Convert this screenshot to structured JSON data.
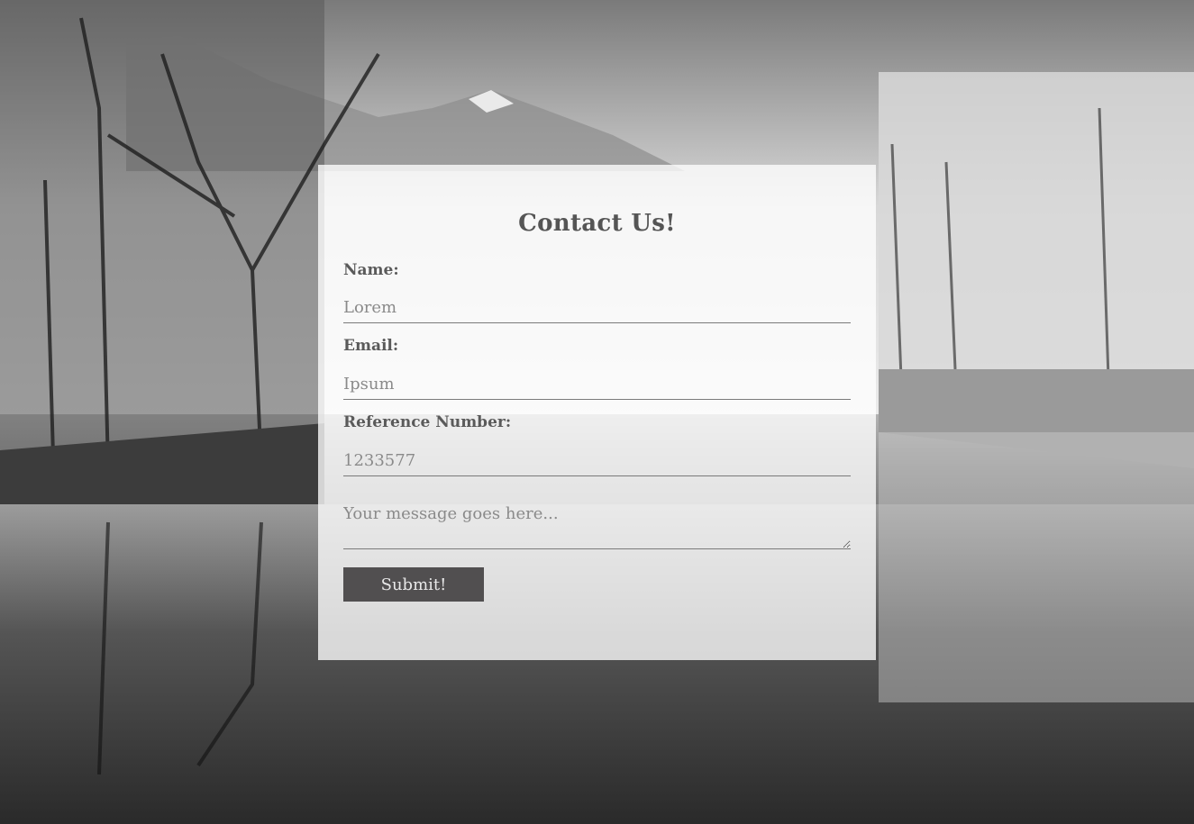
{
  "page": {
    "background_colors": {
      "sky": "#cfcfcf",
      "water": "#3a3a3a",
      "card": "#ffffff"
    }
  },
  "form": {
    "title": "Contact Us!",
    "name": {
      "label": "Name:",
      "placeholder": "Lorem"
    },
    "email": {
      "label": "Email:",
      "placeholder": "Ipsum"
    },
    "reference": {
      "label": "Reference Number:",
      "placeholder": "1233577"
    },
    "message": {
      "placeholder": "Your message goes here..."
    },
    "submit_label": "Submit!"
  },
  "colors": {
    "button": "#514f50",
    "text": "#555555"
  }
}
